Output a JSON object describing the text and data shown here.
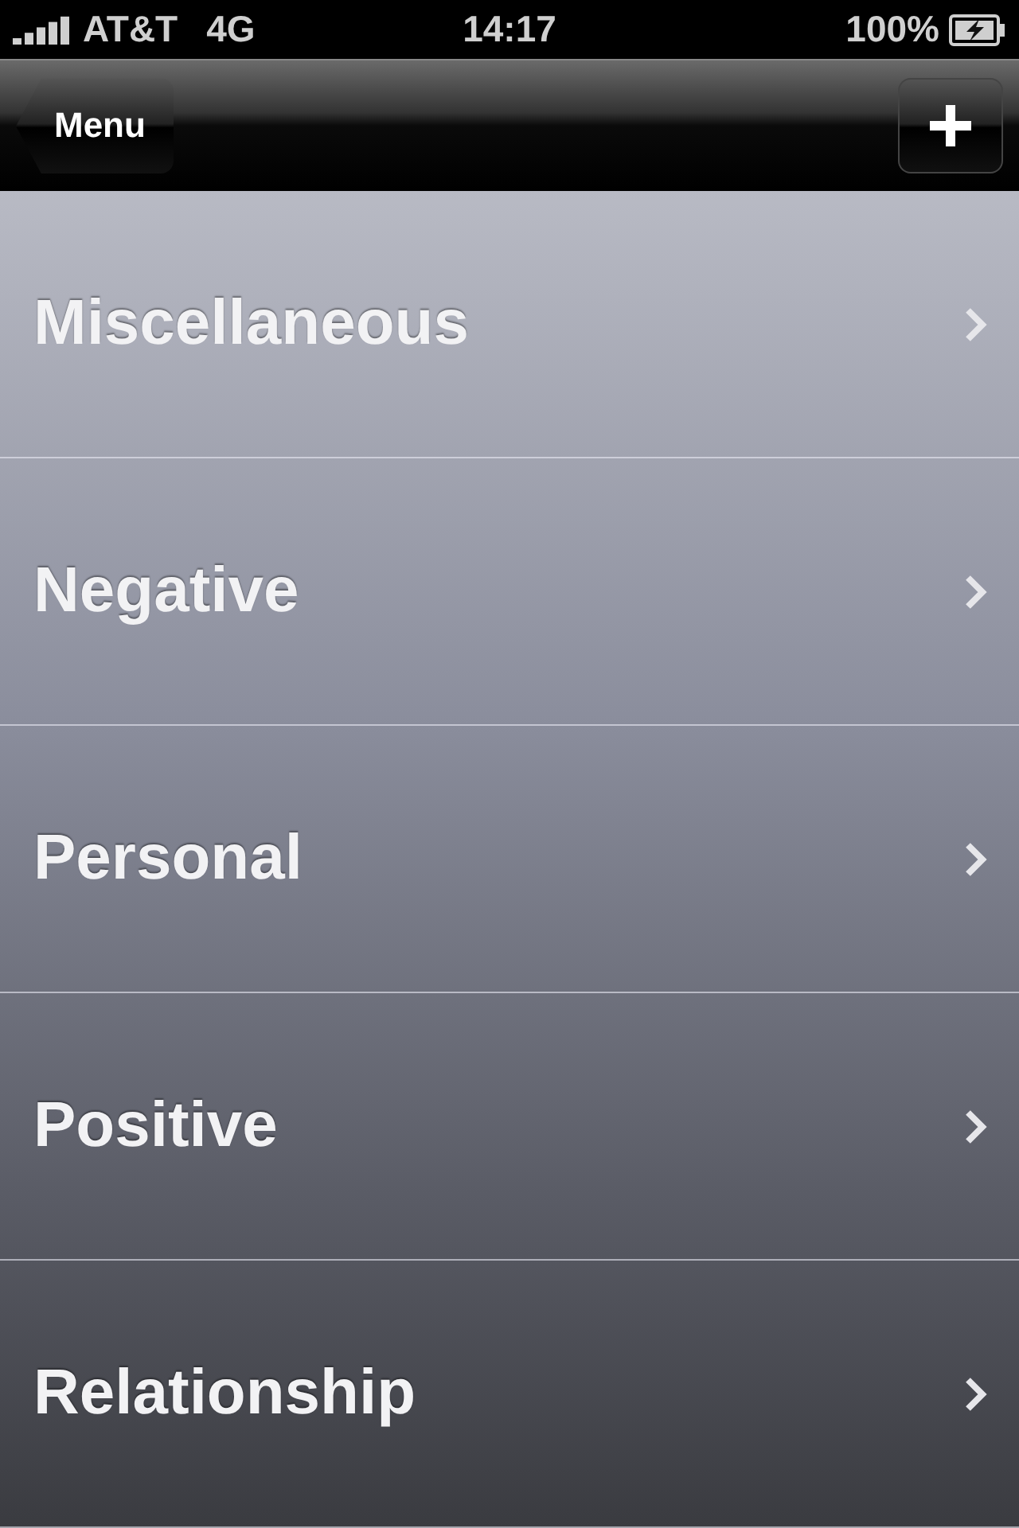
{
  "status_bar": {
    "carrier": "AT&T",
    "network": "4G",
    "time": "14:17",
    "battery": "100%"
  },
  "nav_bar": {
    "back_button": "Menu"
  },
  "categories": [
    {
      "label": "Miscellaneous"
    },
    {
      "label": "Negative"
    },
    {
      "label": "Personal"
    },
    {
      "label": "Positive"
    },
    {
      "label": "Relationship"
    }
  ]
}
